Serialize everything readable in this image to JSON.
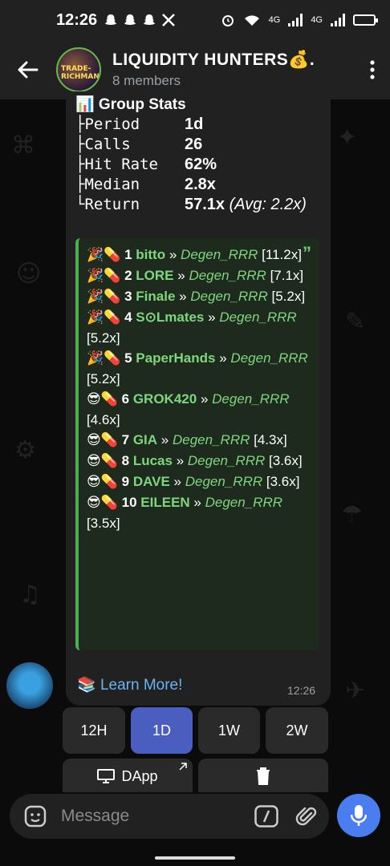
{
  "status_bar": {
    "time": "12:26",
    "network_1": "4G",
    "network_2": "4G"
  },
  "header": {
    "title": "LIQUIDITY HUNTERS💰.",
    "subtitle": "8 members",
    "avatar_text": "TRADE-RICHMAN"
  },
  "stats": {
    "title": "📊 Group Stats",
    "rows": [
      {
        "key": "├Period",
        "value": "1d"
      },
      {
        "key": "├Calls",
        "value": "26"
      },
      {
        "key": "├Hit Rate",
        "value": "62%"
      },
      {
        "key": "├Median",
        "value": "2.8x"
      },
      {
        "key": "└Return",
        "value": "57.1x",
        "extra": "(Avg: 2.2x)"
      }
    ]
  },
  "leaderboard": [
    {
      "emoji": "🎉💊",
      "rank": "1",
      "name": "bitto",
      "sep": "»",
      "caller": "Degen_RRR",
      "mult": "[11.2x]"
    },
    {
      "emoji": "🎉💊",
      "rank": "2",
      "name": "LORE",
      "sep": "»",
      "caller": "Degen_RRR",
      "mult": "[7.1x]"
    },
    {
      "emoji": "🎉💊",
      "rank": "3",
      "name": "Finale",
      "sep": "»",
      "caller": "Degen_RRR",
      "mult": "[5.2x]"
    },
    {
      "emoji": "🎉💊",
      "rank": "4",
      "name": "S⊙Lmates",
      "sep": "»",
      "caller": "Degen_RRR",
      "mult": "[5.2x]"
    },
    {
      "emoji": "🎉💊",
      "rank": "5",
      "name": "PaperHands",
      "sep": "»",
      "caller": "Degen_RRR",
      "mult": "[5.2x]"
    },
    {
      "emoji": "😎💊",
      "rank": "6",
      "name": "GROK420",
      "sep": "»",
      "caller": "Degen_RRR",
      "mult": "[4.6x]"
    },
    {
      "emoji": "😎💊",
      "rank": "7",
      "name": "GIA",
      "sep": "»",
      "caller": "Degen_RRR",
      "mult": "[4.3x]"
    },
    {
      "emoji": "😎💊",
      "rank": "8",
      "name": "Lucas",
      "sep": "»",
      "caller": "Degen_RRR",
      "mult": "[3.6x]"
    },
    {
      "emoji": "😎💊",
      "rank": "9",
      "name": "DAVE",
      "sep": "»",
      "caller": "Degen_RRR",
      "mult": "[3.6x]"
    },
    {
      "emoji": "😎💊",
      "rank": "10",
      "name": "EILEEN",
      "sep": "»",
      "caller": "Degen_RRR",
      "mult": "[3.5x]"
    }
  ],
  "quote_mark": "”",
  "learn_more": {
    "emoji": "📚",
    "label": "Learn More!"
  },
  "message_time": "12:26",
  "keyboard": {
    "periods": [
      "12H",
      "1D",
      "1W",
      "2W"
    ],
    "active": "1D",
    "dapp_label": "DApp"
  },
  "input": {
    "placeholder": "Message"
  },
  "colors": {
    "accent": "#4a5ec0",
    "link": "#6ab3f3",
    "quote_green": "#7ed67e",
    "mic": "#4a7ef0"
  }
}
